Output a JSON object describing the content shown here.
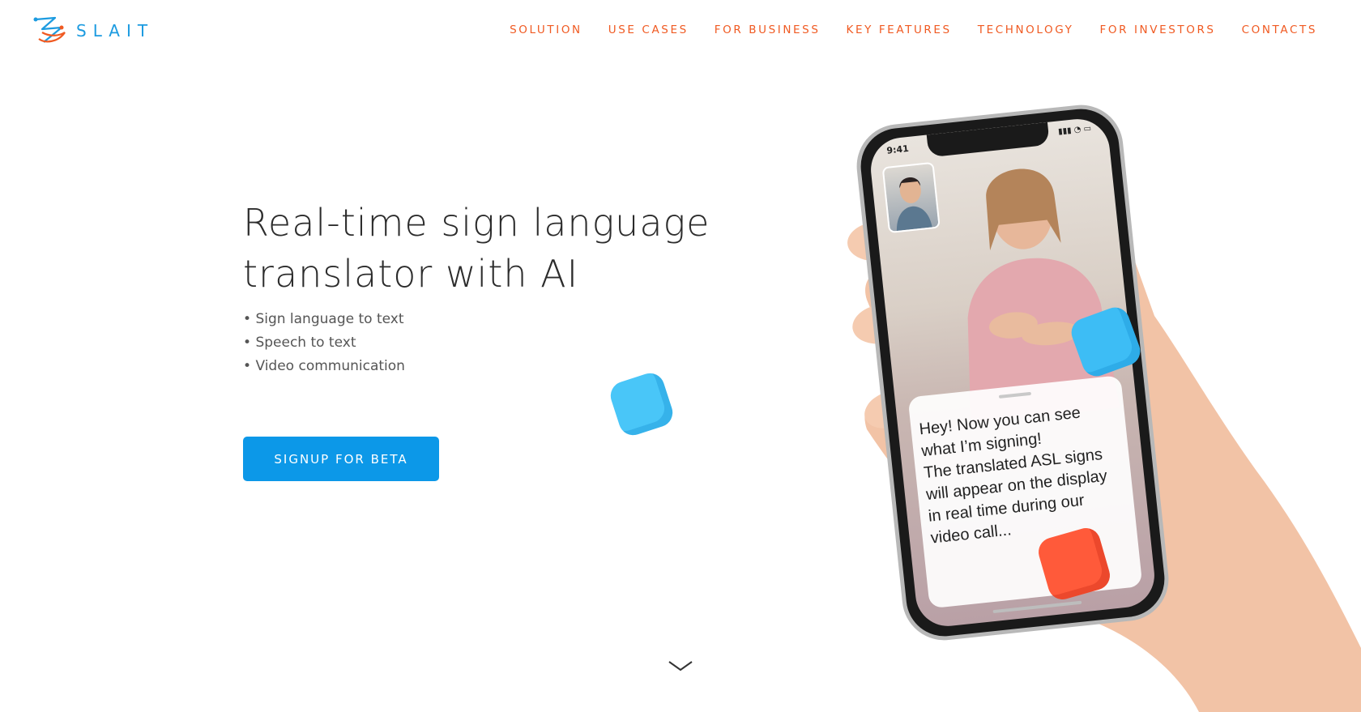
{
  "brand": {
    "name": "SLAIT",
    "color": "#1c9be0"
  },
  "nav": {
    "color": "#f05a22",
    "items": [
      "SOLUTION",
      "USE CASES",
      "FOR BUSINESS",
      "KEY FEATURES",
      "TECHNOLOGY",
      "FOR INVESTORS",
      "CONTACTS"
    ]
  },
  "hero": {
    "title_line1": "Real-time sign language",
    "title_line2": "translator with AI",
    "bullets": [
      "Sign language to text",
      "Speech to text",
      "Video communication"
    ],
    "cta_label": "SIGNUP FOR BETA",
    "cta_color": "#0c98e8"
  },
  "phone": {
    "status_time": "9:41",
    "caption_lines": [
      "Hey! Now you can see",
      "what I’m signing!",
      "The translated ASL signs",
      "will appear on the display",
      "in real time during our",
      "video call..."
    ]
  },
  "icons": {
    "scroll_down": "chevron-down-icon",
    "logo": "slait-logo-icon"
  }
}
